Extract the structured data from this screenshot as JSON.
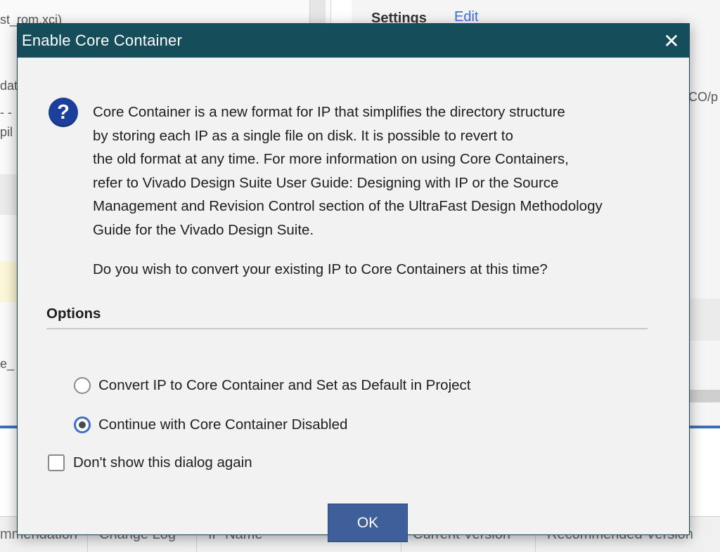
{
  "background": {
    "frag_top_left": "st_rom.xci)",
    "frag_left_1": "dat",
    "frag_left_2": "- -",
    "frag_left_3": "pil",
    "frag_left_4": "e_",
    "settings_label": "Settings",
    "edit_link": "Edit",
    "frag_right": "CO/p",
    "table_headers": [
      "mmendation",
      "Change Log",
      "IP Name",
      "Current Version",
      "Recommended Version"
    ]
  },
  "dialog": {
    "title": "Enable Core Container",
    "close_glyph": "✕",
    "icon_glyph": "?",
    "message_lines": [
      "Core Container is a new format for IP that simplifies the directory structure",
      "by storing each IP as a single file on disk. It is possible to revert to",
      "the old format at any time. For more information on using Core Containers,",
      "refer to Vivado Design Suite User Guide: Designing with IP or the Source",
      "Management and Revision Control section of the UltraFast Design Methodology",
      "Guide for the Vivado Design Suite."
    ],
    "question": "Do you wish to convert your existing IP to Core Containers at this time?",
    "options_label": "Options",
    "option_convert": "Convert IP to Core Container and Set as Default in Project",
    "option_continue": "Continue with Core Container Disabled",
    "selected_option": "continue",
    "dont_show": "Don't show this dialog again",
    "dont_show_checked": false,
    "ok_label": "OK"
  },
  "colors": {
    "titlebar": "#164d5a",
    "ok_button": "#3f5f9a",
    "radio_accent": "#3f6fc6",
    "question_icon": "#1b3f9a"
  }
}
